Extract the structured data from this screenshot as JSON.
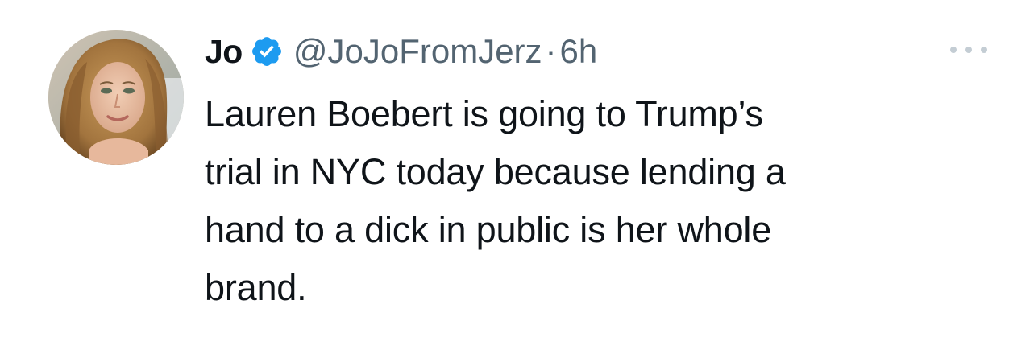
{
  "author": {
    "display_name": "Jo",
    "handle": "@JoJoFromJerz",
    "separator": "·",
    "time": "6h",
    "verified": true
  },
  "tweet": {
    "lines": [
      "Lauren Boebert is going to Trump’s",
      "trial in NYC today because lending a",
      "hand to a dick in public is her whole",
      "brand."
    ]
  },
  "icons": {
    "verified": "verified-badge-icon",
    "more": "more-options-icon"
  },
  "colors": {
    "verified_blue": "#1d9bf0",
    "text_primary": "#0f1419",
    "text_secondary": "#536471"
  }
}
